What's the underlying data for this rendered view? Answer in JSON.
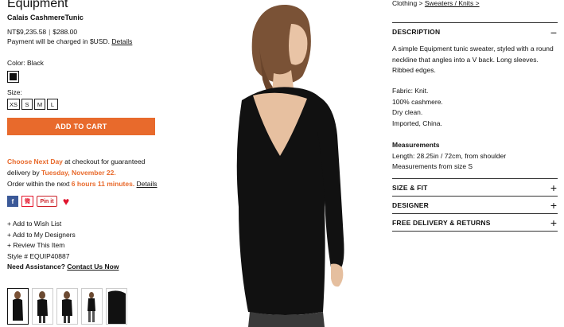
{
  "product": {
    "brand": "Equipment",
    "name": "Calais CashmereTunic",
    "price_local": "NT$9,235.58",
    "price_sep": "|",
    "price_usd": "$288.00",
    "payment_note": "Payment will be charged in $USD.",
    "details_link": "Details",
    "color_label": "Color: Black",
    "size_label": "Size:",
    "sizes": [
      "XS",
      "S",
      "M",
      "L"
    ],
    "add_to_cart": "ADD TO CART"
  },
  "delivery": {
    "line1_highlight": "Choose Next Day",
    "line1_rest": " at checkout for guaranteed",
    "line2_prefix": "delivery by ",
    "line2_date": "Tuesday, November 22.",
    "line3_prefix": "Order within the next ",
    "line3_time": "6 hours 11 minutes.",
    "line3_link": "Details"
  },
  "social": {
    "facebook": "f",
    "weibo": "微",
    "pinterest": "Pin it",
    "heart": "♥"
  },
  "actions": {
    "wish_list": "+ Add to Wish List",
    "my_designers": "+ Add to My Designers",
    "review": "+ Review This Item",
    "style": "Style # EQUIP40887",
    "assist_label": "Need Assistance?",
    "contact": "Contact Us Now"
  },
  "breadcrumb": {
    "part1": "Clothing > ",
    "part2": "Sweaters / Knits >"
  },
  "description": {
    "title": "DESCRIPTION",
    "toggle": "−",
    "text": "A simple Equipment tunic sweater, styled with a round neckline that angles into a V back. Long sleeves. Ribbed edges.",
    "fabric": "Fabric: Knit.",
    "material": "100% cashmere.",
    "care": "Dry clean.",
    "origin": "Imported, China.",
    "measurements_title": "Measurements",
    "length": "Length: 28.25in / 72cm, from shoulder",
    "from_size": "Measurements from size S"
  },
  "sections": [
    {
      "title": "SIZE & FIT",
      "toggle": "+"
    },
    {
      "title": "DESIGNER",
      "toggle": "+"
    },
    {
      "title": "FREE DELIVERY & RETURNS",
      "toggle": "+"
    }
  ],
  "colors": {
    "accent": "#e86a2c",
    "text": "#111111",
    "facebook": "#3b5998",
    "heart": "#e0142d"
  }
}
